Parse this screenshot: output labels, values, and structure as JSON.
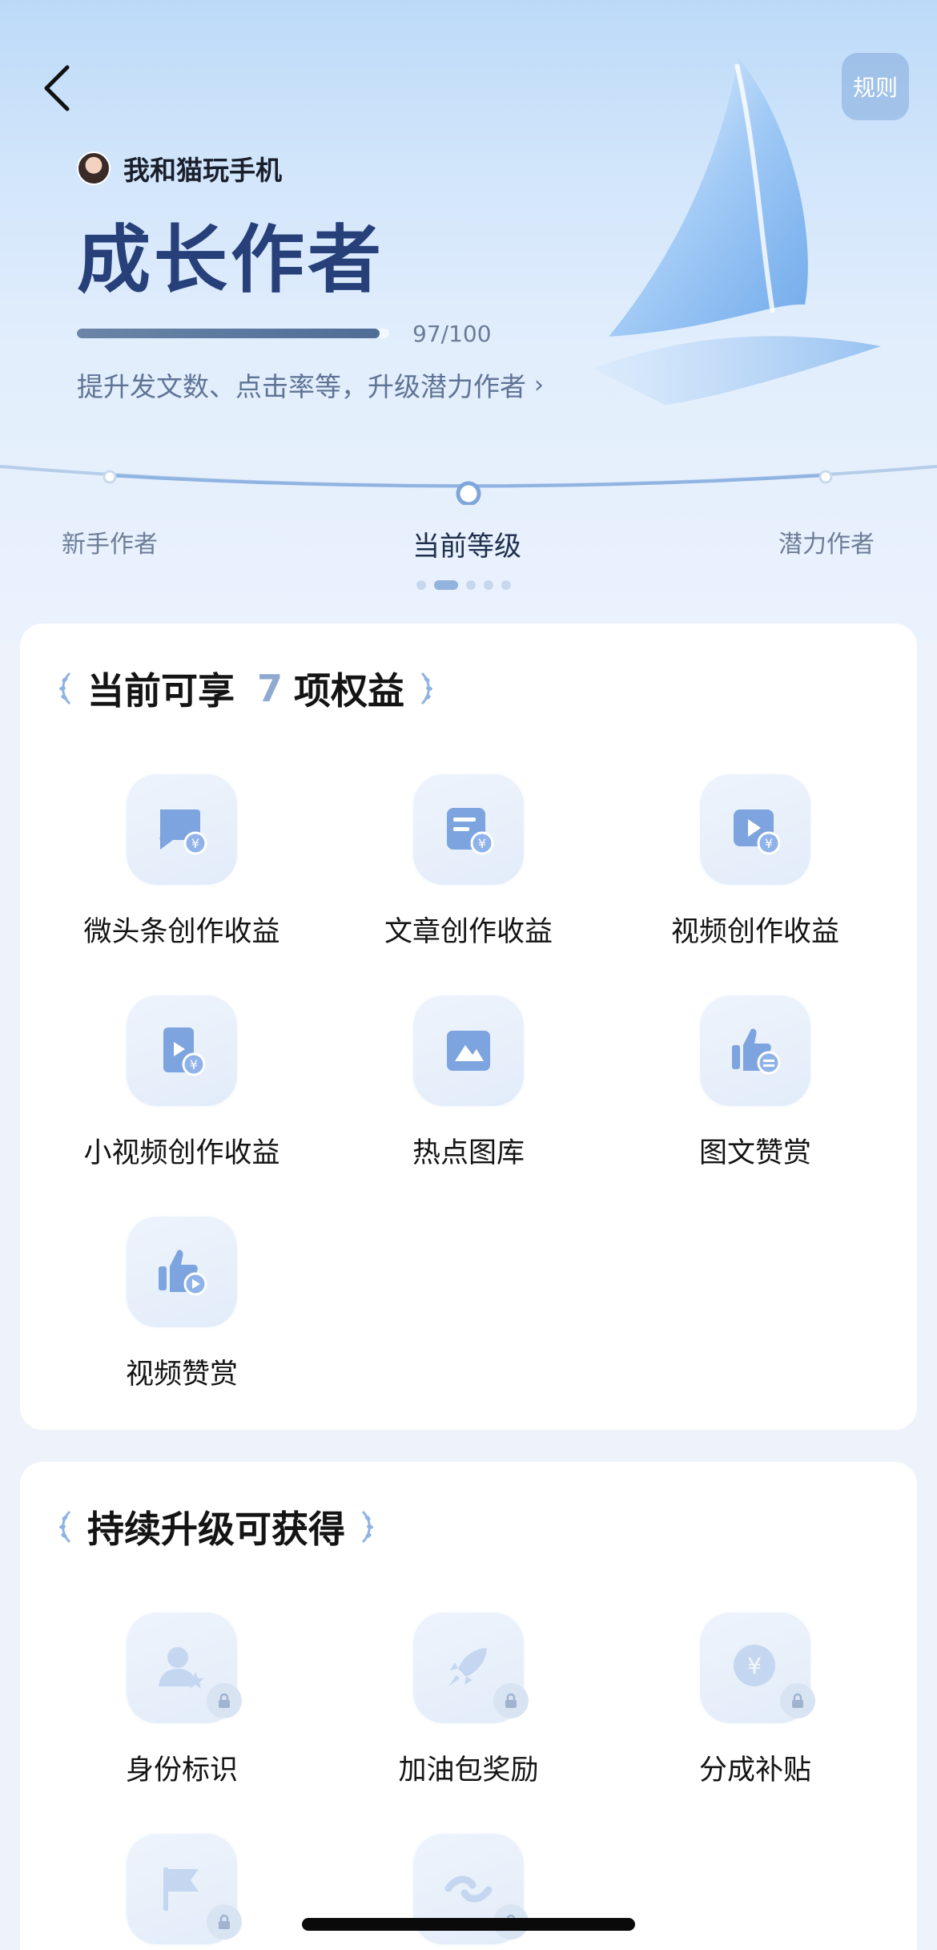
{
  "header": {
    "rules_label": "规则"
  },
  "user": {
    "name": "我和猫玩手机"
  },
  "level": {
    "title": "成长作者",
    "progress_text": "97/100",
    "progress_fraction": 0.97,
    "hint": "提升发文数、点击率等，升级潜力作者",
    "prev_label": "新手作者",
    "current_label": "当前等级",
    "next_label": "潜力作者"
  },
  "current_benefits": {
    "title_prefix": "当前可享",
    "count": "7",
    "title_suffix": "项权益",
    "items": [
      {
        "label": "微头条创作收益",
        "icon": "comment-yuan-icon"
      },
      {
        "label": "文章创作收益",
        "icon": "article-yuan-icon"
      },
      {
        "label": "视频创作收益",
        "icon": "video-yuan-icon"
      },
      {
        "label": "小视频创作收益",
        "icon": "short-video-yuan-icon"
      },
      {
        "label": "热点图库",
        "icon": "image-gallery-icon"
      },
      {
        "label": "图文赞赏",
        "icon": "thumbs-up-text-icon"
      },
      {
        "label": "视频赞赏",
        "icon": "thumbs-up-video-icon"
      }
    ]
  },
  "upgrade_benefits": {
    "title": "持续升级可获得",
    "items": [
      {
        "label": "身份标识",
        "icon": "user-star-icon"
      },
      {
        "label": "加油包奖励",
        "icon": "rocket-icon"
      },
      {
        "label": "分成补贴",
        "icon": "yuan-coin-icon"
      },
      {
        "label": "",
        "icon": "flag-icon"
      },
      {
        "label": "",
        "icon": "link-icon"
      }
    ]
  },
  "colors": {
    "accent": "#8fa9d1",
    "title_blue": "#27407a",
    "icon_blue": "#6f97d6"
  }
}
